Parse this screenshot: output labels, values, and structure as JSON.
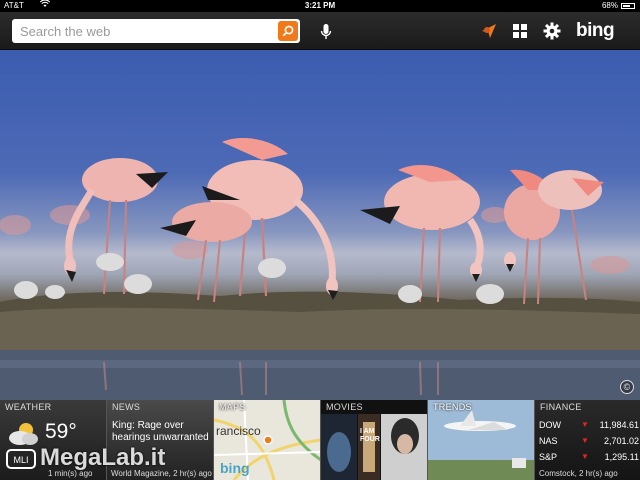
{
  "status_bar": {
    "carrier": "AT&T",
    "time": "3:21 PM",
    "battery": "68%"
  },
  "header": {
    "search_placeholder": "Search the web",
    "logo": "bing"
  },
  "tiles": {
    "weather": {
      "title": "WEATHER",
      "temperature": "59°",
      "footer": "1 min(s) ago"
    },
    "news": {
      "title": "NEWS",
      "headline": "King: Rage over hearings unwarranted",
      "footer": "World Magazine, 2 hr(s) ago"
    },
    "maps": {
      "title": "MAPS",
      "city": "rancisco",
      "logo": "bing"
    },
    "movies": {
      "title": "MOVIES",
      "poster_text": "I AM FOUR"
    },
    "trends": {
      "title": "TRENDS"
    },
    "finance": {
      "title": "FINANCE",
      "rows": [
        {
          "symbol": "DOW",
          "value": "11,984.61"
        },
        {
          "symbol": "NAS",
          "value": "2,701.02"
        },
        {
          "symbol": "S&P",
          "value": "1,295.11"
        }
      ],
      "footer": "Comstock, 2 hr(s) ago"
    }
  },
  "watermark": "MegaLab.it",
  "colors": {
    "accent": "#f07a1a",
    "down": "#e0261f"
  }
}
